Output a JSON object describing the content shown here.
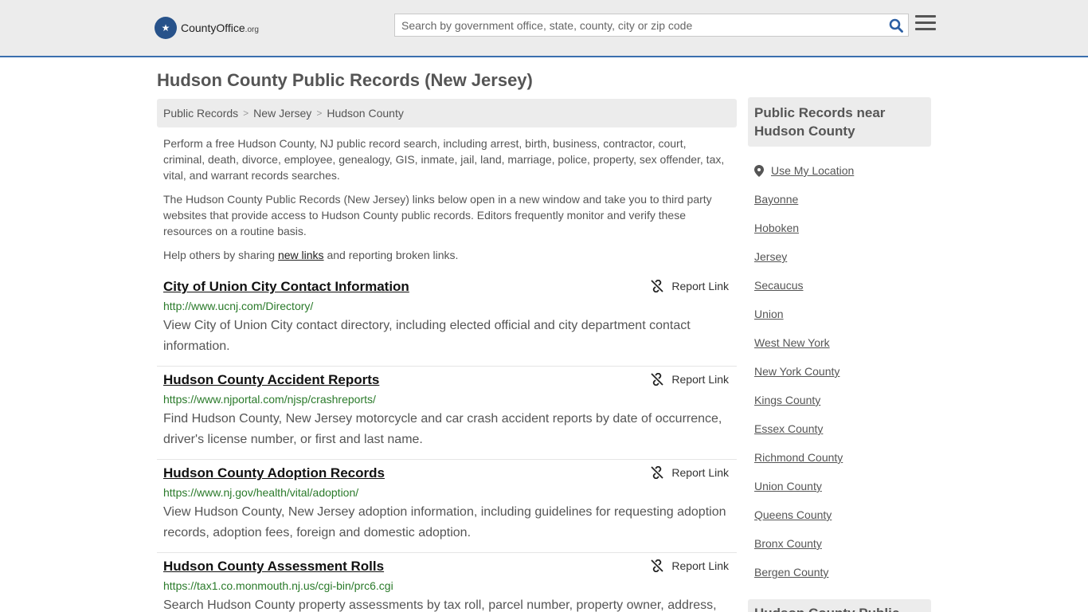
{
  "header": {
    "logo_main": "CountyOffice",
    "logo_tld": ".org",
    "search_placeholder": "Search by government office, state, county, city or zip code"
  },
  "page_title": "Hudson County Public Records (New Jersey)",
  "breadcrumb": [
    "Public Records",
    "New Jersey",
    "Hudson County"
  ],
  "intro": {
    "p1": "Perform a free Hudson County, NJ public record search, including arrest, birth, business, contractor, court, criminal, death, divorce, employee, genealogy, GIS, inmate, jail, land, marriage, police, property, sex offender, tax, vital, and warrant records searches.",
    "p2": "The Hudson County Public Records (New Jersey) links below open in a new window and take you to third party websites that provide access to Hudson County public records. Editors frequently monitor and verify these resources on a routine basis.",
    "p3_before": "Help others by sharing ",
    "p3_link": "new links",
    "p3_after": " and reporting broken links."
  },
  "report_label": "Report Link",
  "records": [
    {
      "title": "City of Union City Contact Information",
      "url": "http://www.ucnj.com/Directory/",
      "desc": "View City of Union City contact directory, including elected official and city department contact information."
    },
    {
      "title": "Hudson County Accident Reports",
      "url": "https://www.njportal.com/njsp/crashreports/",
      "desc": "Find Hudson County, New Jersey motorcycle and car crash accident reports by date of occurrence, driver's license number, or first and last name."
    },
    {
      "title": "Hudson County Adoption Records",
      "url": "https://www.nj.gov/health/vital/adoption/",
      "desc": "View Hudson County, New Jersey adoption information, including guidelines for requesting adoption records, adoption fees, foreign and domestic adoption."
    },
    {
      "title": "Hudson County Assessment Rolls",
      "url": "https://tax1.co.monmouth.nj.us/cgi-bin/prc6.cgi",
      "desc": "Search Hudson County property assessments by tax roll, parcel number, property owner, address,"
    }
  ],
  "sidebar": {
    "heading": "Public Records near Hudson County",
    "use_location": "Use My Location",
    "items": [
      "Bayonne",
      "Hoboken",
      "Jersey",
      "Secaucus",
      "Union",
      "West New York",
      "New York County",
      "Kings County",
      "Essex County",
      "Richmond County",
      "Union County",
      "Queens County",
      "Bronx County",
      "Bergen County"
    ],
    "heading2": "Hudson County Public"
  }
}
